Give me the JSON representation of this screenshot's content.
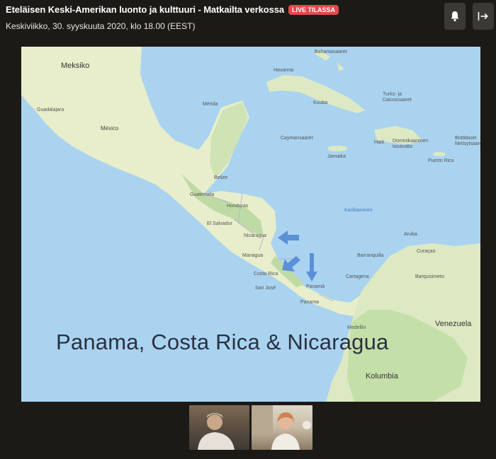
{
  "header": {
    "title": "Eteläisen Keski-Amerikan luonto ja kulttuuri - Matkailta verkossa",
    "live_badge": "LIVE TILASSA",
    "subtitle": "Keskiviikko, 30. syyskuuta 2020, klo 18.00 (EEST)",
    "notifications_icon": "bell-icon",
    "leave_icon": "exit-icon"
  },
  "slide": {
    "caption": "Panama, Costa Rica & Nicaragua",
    "map_labels": {
      "meksiko": "Meksiko",
      "mexico": "México",
      "guadalajara": "Guadalajara",
      "merida": "Mérida",
      "belize": "Belize",
      "guatemala": "Guatemala",
      "honduras": "Honduras",
      "el_salvador": "El Salvador",
      "nicaragua": "Nicaragua",
      "managua": "Managua",
      "costa_rica": "Costa Rica",
      "san_jose": "San José",
      "panama_region": "Panamá",
      "panama": "Panama",
      "havanna": "Havanna",
      "kuuba": "Kuuba",
      "bahamasaaret": "Bahamasaaret",
      "caymansaaret": "Caymansaaret",
      "jamaika": "Jamaika",
      "haiti": "Haiti",
      "dominikaaninen": "Dominikaaninen tasavalta",
      "puerto_rico": "Puerto Rico",
      "turks": "Turks- ja Caicossaaret",
      "brittilaiset": "Brittiläiset Neitsytsaaret",
      "karibianmeri": "Karibianmeri",
      "aruba": "Aruba",
      "curacao": "Curaçao",
      "barranquilla": "Barranquilla",
      "cartagena": "Cartagena",
      "barquisimeto": "Barquisimeto",
      "medellin": "Medellín",
      "venezuela": "Venezuela",
      "kolumbia": "Kolumbia"
    },
    "arrow_color": "#5b8fd6"
  },
  "participants": [
    {
      "name": "participant-1"
    },
    {
      "name": "participant-2"
    }
  ]
}
